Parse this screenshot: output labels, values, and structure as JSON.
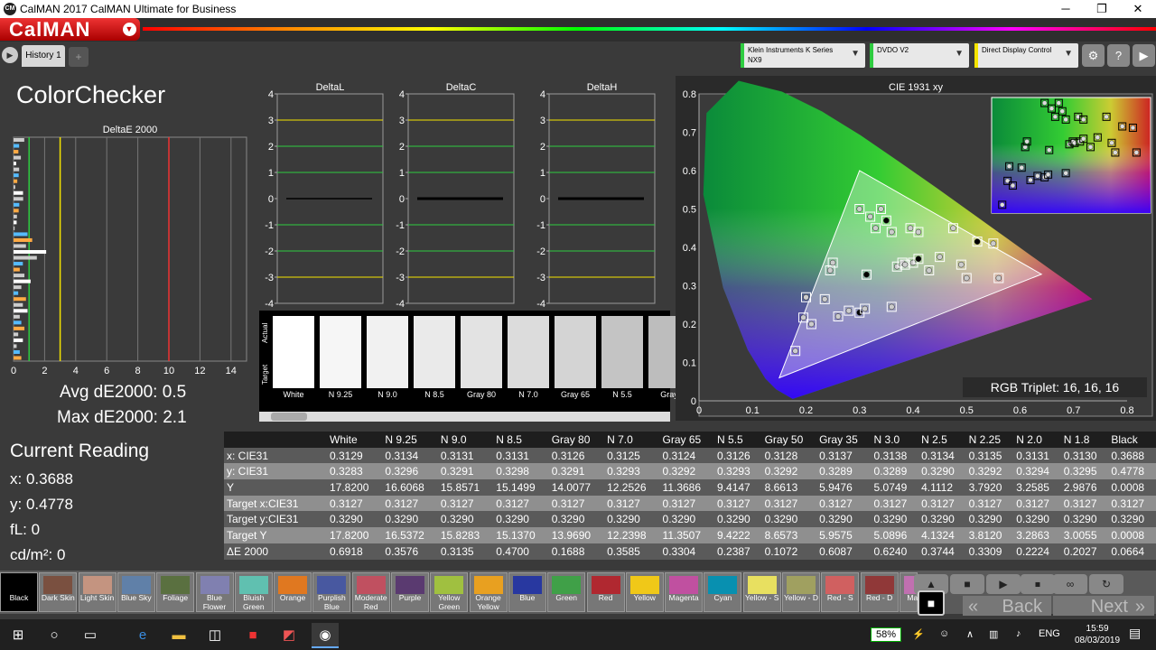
{
  "window": {
    "title": "CalMAN 2017 CalMAN Ultimate for Business",
    "minimize": "─",
    "maximize": "❐",
    "close": "✕"
  },
  "logo": {
    "text": "CalMAN",
    "arrow": "▼"
  },
  "tabs": {
    "back_arrow": "▶",
    "history": "History 1",
    "add": "+"
  },
  "devices": [
    {
      "line1": "Klein Instruments K Series",
      "line2": "NX9",
      "color": "#2ecc40"
    },
    {
      "line1": "DVDO V2",
      "line2": "",
      "color": "#2ecc40"
    },
    {
      "line1": "Direct Display Control",
      "line2": "",
      "color": "#f5e400"
    }
  ],
  "toolbar_icons": [
    "gear-icon",
    "help-icon",
    "menu-icon"
  ],
  "toolbar_glyphs": [
    "⚙",
    "?",
    "▶"
  ],
  "colorchecker": {
    "title": "ColorChecker",
    "avg": "Avg dE2000: 0.5",
    "max": "Max dE2000: 2.1"
  },
  "current": {
    "title": "Current Reading",
    "x": "x: 0.3688",
    "y": "y: 0.4778",
    "fl": "fL: 0",
    "cdm": "cd/m²: 0"
  },
  "chart_data": [
    {
      "type": "bar",
      "orientation": "horizontal",
      "title": "DeltaE 2000",
      "xlim": [
        0,
        15
      ],
      "xticks": [
        "0",
        "2",
        "4",
        "6",
        "8",
        "10",
        "12",
        "14"
      ],
      "reference_lines": [
        1,
        3,
        10
      ],
      "values": [
        0.69,
        0.36,
        0.31,
        0.47,
        0.17,
        0.36,
        0.33,
        0.24,
        0.11,
        0.61,
        0.62,
        0.37,
        0.33,
        0.22,
        0.2,
        0.07,
        0.9,
        1.2,
        0.8,
        2.1,
        1.5,
        0.6,
        0.4,
        0.7,
        1.1,
        0.5,
        0.3,
        0.8,
        0.6,
        0.9,
        0.4,
        0.5,
        0.7,
        0.3,
        0.6,
        0.2,
        0.4,
        0.5
      ]
    },
    {
      "type": "line",
      "title": "DeltaL",
      "ylim": [
        -4,
        4
      ],
      "yticks": [
        "4",
        "3",
        "2",
        "1",
        "0",
        "-1",
        "-2",
        "-3",
        "-4"
      ]
    },
    {
      "type": "line",
      "title": "DeltaC",
      "ylim": [
        -4,
        4
      ],
      "yticks": [
        "4",
        "3",
        "2",
        "1",
        "0",
        "-1",
        "-2",
        "-3",
        "-4"
      ]
    },
    {
      "type": "line",
      "title": "DeltaH",
      "ylim": [
        -4,
        4
      ],
      "yticks": [
        "4",
        "3",
        "2",
        "1",
        "0",
        "-1",
        "-2",
        "-3",
        "-4"
      ]
    },
    {
      "type": "scatter",
      "title": "CIE 1931 xy",
      "xlim": [
        0,
        0.8
      ],
      "ylim": [
        0,
        0.8
      ],
      "xticks": [
        "0",
        "0.1",
        "0.2",
        "0.3",
        "0.4",
        "0.5",
        "0.6",
        "0.7",
        "0.8"
      ],
      "yticks": [
        "0",
        "0.1",
        "0.2",
        "0.3",
        "0.4",
        "0.5",
        "0.6",
        "0.7",
        "0.8"
      ],
      "gamut": [
        [
          0.64,
          0.33
        ],
        [
          0.3,
          0.6
        ],
        [
          0.15,
          0.06
        ]
      ],
      "points": [
        [
          0.313,
          0.329
        ],
        [
          0.195,
          0.217
        ],
        [
          0.21,
          0.2
        ],
        [
          0.235,
          0.265
        ],
        [
          0.245,
          0.34
        ],
        [
          0.26,
          0.22
        ],
        [
          0.28,
          0.235
        ],
        [
          0.3,
          0.23
        ],
        [
          0.31,
          0.24
        ],
        [
          0.36,
          0.245
        ],
        [
          0.37,
          0.35
        ],
        [
          0.38,
          0.36
        ],
        [
          0.385,
          0.355
        ],
        [
          0.4,
          0.36
        ],
        [
          0.41,
          0.37
        ],
        [
          0.43,
          0.34
        ],
        [
          0.45,
          0.375
        ],
        [
          0.49,
          0.355
        ],
        [
          0.5,
          0.32
        ],
        [
          0.56,
          0.32
        ],
        [
          0.475,
          0.45
        ],
        [
          0.52,
          0.415
        ],
        [
          0.33,
          0.45
        ],
        [
          0.36,
          0.44
        ],
        [
          0.395,
          0.45
        ],
        [
          0.3,
          0.5
        ],
        [
          0.32,
          0.48
        ],
        [
          0.34,
          0.5
        ],
        [
          0.35,
          0.47
        ],
        [
          0.25,
          0.36
        ],
        [
          0.18,
          0.13
        ],
        [
          0.2,
          0.27
        ],
        [
          0.41,
          0.44
        ],
        [
          0.55,
          0.41
        ]
      ]
    }
  ],
  "swatches": {
    "actual_label": "Actual",
    "target_label": "Target",
    "items": [
      {
        "label": "White",
        "color": "#ffffff"
      },
      {
        "label": "N 9.25",
        "color": "#f6f6f6"
      },
      {
        "label": "N 9.0",
        "color": "#f1f1f1"
      },
      {
        "label": "N 8.5",
        "color": "#eaeaea"
      },
      {
        "label": "Gray 80",
        "color": "#e3e3e3"
      },
      {
        "label": "N 7.0",
        "color": "#dcdcdc"
      },
      {
        "label": "Gray 65",
        "color": "#d4d4d4"
      },
      {
        "label": "N 5.5",
        "color": "#c4c4c4"
      },
      {
        "label": "Gray",
        "color": "#bdbdbd"
      }
    ]
  },
  "rgb_triplet": "RGB Triplet: 16, 16, 16",
  "table": {
    "headers": [
      "",
      "White",
      "N 9.25",
      "N 9.0",
      "N 8.5",
      "Gray 80",
      "N 7.0",
      "Gray 65",
      "N 5.5",
      "Gray 50",
      "Gray 35",
      "N 3.0",
      "N 2.5",
      "N 2.25",
      "N 2.0",
      "N 1.8",
      "Black"
    ],
    "rows": [
      [
        "x: CIE31",
        "0.3129",
        "0.3134",
        "0.3131",
        "0.3131",
        "0.3126",
        "0.3125",
        "0.3124",
        "0.3126",
        "0.3128",
        "0.3137",
        "0.3138",
        "0.3134",
        "0.3135",
        "0.3131",
        "0.3130",
        "0.3688"
      ],
      [
        "y: CIE31",
        "0.3283",
        "0.3296",
        "0.3291",
        "0.3298",
        "0.3291",
        "0.3293",
        "0.3292",
        "0.3293",
        "0.3292",
        "0.3289",
        "0.3289",
        "0.3290",
        "0.3292",
        "0.3294",
        "0.3295",
        "0.4778"
      ],
      [
        "Y",
        "17.8200",
        "16.6068",
        "15.8571",
        "15.1499",
        "14.0077",
        "12.2526",
        "11.3686",
        "9.4147",
        "8.6613",
        "5.9476",
        "5.0749",
        "4.1112",
        "3.7920",
        "3.2585",
        "2.9876",
        "0.0008"
      ],
      [
        "Target x:CIE31",
        "0.3127",
        "0.3127",
        "0.3127",
        "0.3127",
        "0.3127",
        "0.3127",
        "0.3127",
        "0.3127",
        "0.3127",
        "0.3127",
        "0.3127",
        "0.3127",
        "0.3127",
        "0.3127",
        "0.3127",
        "0.3127"
      ],
      [
        "Target y:CIE31",
        "0.3290",
        "0.3290",
        "0.3290",
        "0.3290",
        "0.3290",
        "0.3290",
        "0.3290",
        "0.3290",
        "0.3290",
        "0.3290",
        "0.3290",
        "0.3290",
        "0.3290",
        "0.3290",
        "0.3290",
        "0.3290"
      ],
      [
        "Target Y",
        "17.8200",
        "16.5372",
        "15.8283",
        "15.1370",
        "13.9690",
        "12.2398",
        "11.3507",
        "9.4222",
        "8.6573",
        "5.9575",
        "5.0896",
        "4.1324",
        "3.8120",
        "3.2863",
        "3.0055",
        "0.0008"
      ],
      [
        "ΔE 2000",
        "0.6918",
        "0.3576",
        "0.3135",
        "0.4700",
        "0.1688",
        "0.3585",
        "0.3304",
        "0.2387",
        "0.1072",
        "0.6087",
        "0.6240",
        "0.3744",
        "0.3309",
        "0.2224",
        "0.2027",
        "0.0664"
      ]
    ]
  },
  "patches": [
    {
      "label": "Black",
      "color": "#000000"
    },
    {
      "label": "Dark Skin",
      "color": "#7a5040"
    },
    {
      "label": "Light Skin",
      "color": "#c49480"
    },
    {
      "label": "Blue Sky",
      "color": "#6080a8"
    },
    {
      "label": "Foliage",
      "color": "#5a7040"
    },
    {
      "label": "Blue Flower",
      "color": "#8080b0"
    },
    {
      "label": "Bluish Green",
      "color": "#60c0b0"
    },
    {
      "label": "Orange",
      "color": "#e07820"
    },
    {
      "label": "Purplish Blue",
      "color": "#4858a0"
    },
    {
      "label": "Moderate Red",
      "color": "#c05060"
    },
    {
      "label": "Purple",
      "color": "#5a3a70"
    },
    {
      "label": "Yellow Green",
      "color": "#a0c040"
    },
    {
      "label": "Orange Yellow",
      "color": "#e8a020"
    },
    {
      "label": "Blue",
      "color": "#2838a0"
    },
    {
      "label": "Green",
      "color": "#40a048"
    },
    {
      "label": "Red",
      "color": "#b02830"
    },
    {
      "label": "Yellow",
      "color": "#f0c818"
    },
    {
      "label": "Magenta",
      "color": "#c050a0"
    },
    {
      "label": "Cyan",
      "color": "#0890b0"
    },
    {
      "label": "Yellow - S",
      "color": "#e8e060"
    },
    {
      "label": "Yellow - D",
      "color": "#a0a060"
    },
    {
      "label": "Red - S",
      "color": "#d06060"
    },
    {
      "label": "Red - D",
      "color": "#903838"
    },
    {
      "label": "Ma - S",
      "color": "#c070b0"
    }
  ],
  "nav": {
    "back": "Back",
    "next": "Next",
    "back_arrow": "«",
    "next_arrow": "»"
  },
  "controls": [
    "▲",
    "■",
    "▶",
    "⏹",
    "∞",
    "↻"
  ],
  "taskbar": {
    "battery": "58%",
    "lang": "ENG",
    "time": "15:59",
    "date": "08/03/2019"
  }
}
